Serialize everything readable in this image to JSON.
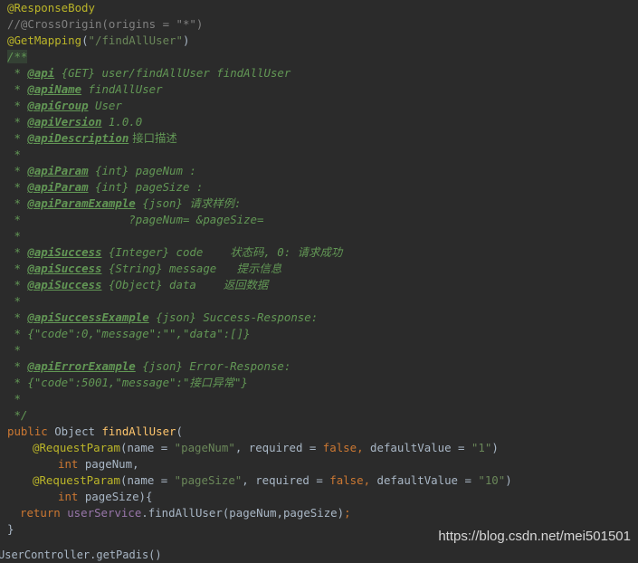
{
  "code": {
    "l1": "@ResponseBody",
    "l2": "//@CrossOrigin(origins = \"*\")",
    "l3_ann": "@GetMapping",
    "l3_open": "(",
    "l3_str": "\"/findAllUser\"",
    "l3_close": ")",
    "l4_open": "/**",
    "doc_star": " * ",
    "api_tag": "@api",
    "api_rest": " {GET} user/findAllUser findAllUser",
    "apiName_tag": "@apiName",
    "apiName_rest": " findAllUser",
    "apiGroup_tag": "@apiGroup",
    "apiGroup_rest": " User",
    "apiVersion_tag": "@apiVersion",
    "apiVersion_rest": " 1.0.0",
    "apiDescription_tag": "@apiDescription",
    "apiDescription_rest": " 接口描述",
    "blank_star": " *",
    "param1_tag": "@apiParam",
    "param1_rest": " {int} pageNum :",
    "param2_tag": "@apiParam",
    "param2_rest": " {int} pageSize :",
    "paramEx_tag": "@apiParamExample",
    "paramEx_rest": " {json} 请求样例:",
    "paramEx_cont": " *                ?pageNum= &pageSize=",
    "succ1_tag": "@apiSuccess",
    "succ1_rest": " {Integer} code    状态码, 0: 请求成功",
    "succ2_tag": "@apiSuccess",
    "succ2_rest": " {String} message   提示信息",
    "succ3_tag": "@apiSuccess",
    "succ3_rest": " {Object} data    返回数据",
    "succEx_tag": "@apiSuccessExample",
    "succEx_rest": " {json} Success-Response:",
    "succEx_body": " * {\"code\":0,\"message\":\"\",\"data\":[]}",
    "errEx_tag": "@apiErrorExample",
    "errEx_rest": " {json} Error-Response:",
    "errEx_body": " * {\"code\":5001,\"message\":\"接口异常\"}",
    "doc_close": " */",
    "sig_kw": "public",
    "sig_type": " Object ",
    "sig_fn": "findAllUser",
    "sig_paren": "(",
    "rp1_ann": "@RequestParam",
    "rp1_a": "(name = ",
    "rp1_name": "\"pageNum\"",
    "rp1_b": ", required = ",
    "rp1_false": "false,",
    "rp1_c": " defaultValue = ",
    "rp1_dv": "\"1\"",
    "rp1_d": ")",
    "p1_kw": "int",
    "p1_name": " pageNum,",
    "rp2_ann": "@RequestParam",
    "rp2_a": "(name = ",
    "rp2_name": "\"pageSize\"",
    "rp2_b": ", required = ",
    "rp2_false": "false,",
    "rp2_c": " defaultValue = ",
    "rp2_dv": "\"10\"",
    "rp2_d": ")",
    "p2_kw": "int",
    "p2_name": " pageSize){",
    "ret_kw": "return",
    "ret_field": " userService",
    "ret_call": ".findAllUser(pageNum,pageSize)",
    "ret_semi": ";",
    "close_brace": "}",
    "partial_line": "UserController.getPadis()"
  },
  "watermark": "https://blog.csdn.net/mei501501"
}
